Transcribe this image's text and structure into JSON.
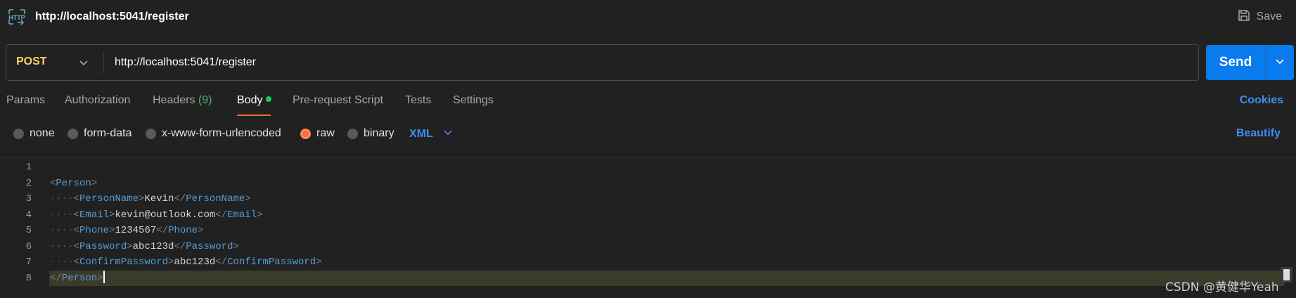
{
  "header": {
    "icon": "http-icon",
    "title": "http://localhost:5041/register",
    "save_label": "Save"
  },
  "request": {
    "method": "POST",
    "url": "http://localhost:5041/register",
    "send_label": "Send"
  },
  "tabs": [
    {
      "label": "Params"
    },
    {
      "label": "Authorization"
    },
    {
      "label": "Headers",
      "count": "(9)"
    },
    {
      "label": "Body",
      "active": true
    },
    {
      "label": "Pre-request Script"
    },
    {
      "label": "Tests"
    },
    {
      "label": "Settings"
    }
  ],
  "cookies_label": "Cookies",
  "body_types": [
    {
      "label": "none"
    },
    {
      "label": "form-data"
    },
    {
      "label": "x-www-form-urlencoded"
    },
    {
      "label": "raw",
      "selected": true
    },
    {
      "label": "binary"
    }
  ],
  "language": "XML",
  "beautify_label": "Beautify",
  "editor": {
    "line_numbers": [
      "1",
      "2",
      "3",
      "4",
      "5",
      "6",
      "7",
      "8"
    ],
    "lines": [
      "",
      "<Person>",
      "    <PersonName>Kevin</PersonName>",
      "    <Email>kevin@outlook.com</Email>",
      "    <Phone>1234567</Phone>",
      "    <Password>abc123d</Password>",
      "    <ConfirmPassword>abc123d</ConfirmPassword>",
      "</Person>"
    ],
    "current_line": 8
  },
  "watermark": "CSDN @黄健华Yeah",
  "colors": {
    "accent": "#ff6c37",
    "send": "#097bed",
    "link": "#3d8ff0",
    "method": "#ffd166"
  }
}
